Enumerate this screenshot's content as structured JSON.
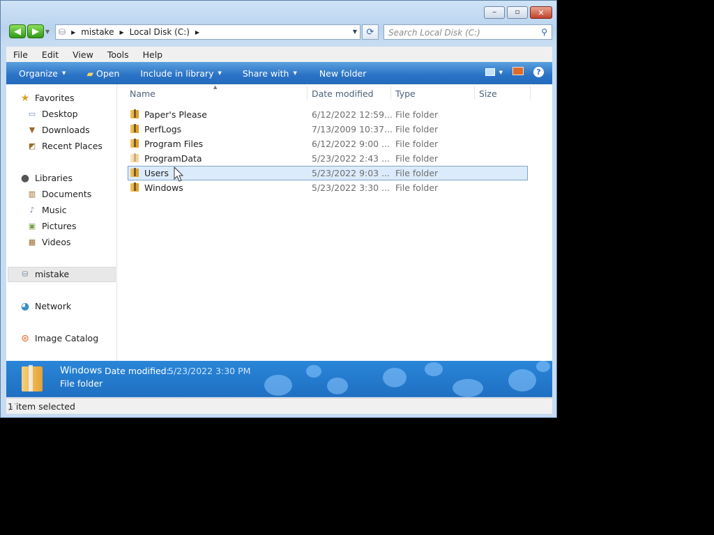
{
  "window": {
    "caption": {
      "minimize": "‒",
      "maximize": "▫",
      "close": "✕"
    }
  },
  "nav": {
    "back_icon": "arrow-left",
    "forward_icon": "arrow-right"
  },
  "address": {
    "crumbs": [
      "mistake",
      "Local Disk (C:)"
    ]
  },
  "search": {
    "placeholder": "Search Local Disk (C:)"
  },
  "menu": [
    "File",
    "Edit",
    "View",
    "Tools",
    "Help"
  ],
  "toolbar": {
    "organize": "Organize",
    "open": "Open",
    "include_in_library": "Include in library",
    "share_with": "Share with",
    "new_folder": "New folder",
    "help": "?"
  },
  "navpane": {
    "favorites": "Favorites",
    "desktop": "Desktop",
    "downloads": "Downloads",
    "recent_places": "Recent Places",
    "libraries": "Libraries",
    "documents": "Documents",
    "music": "Music",
    "pictures": "Pictures",
    "videos": "Videos",
    "computer": "mistake",
    "network": "Network",
    "image_catalog": "Image Catalog"
  },
  "columns": {
    "name": "Name",
    "date": "Date modified",
    "type": "Type",
    "size": "Size"
  },
  "files": [
    {
      "name": "Paper's Please",
      "date": "6/12/2022 12:59...",
      "type": "File folder"
    },
    {
      "name": "PerfLogs",
      "date": "7/13/2009 10:37...",
      "type": "File folder"
    },
    {
      "name": "Program Files",
      "date": "6/12/2022 9:00 ...",
      "type": "File folder"
    },
    {
      "name": "ProgramData",
      "date": "5/23/2022 2:43 ...",
      "type": "File folder"
    },
    {
      "name": "Users",
      "date": "5/23/2022 9:03 ...",
      "type": "File folder"
    },
    {
      "name": "Windows",
      "date": "5/23/2022 3:30 ...",
      "type": "File folder"
    }
  ],
  "details": {
    "name": "Windows",
    "date_label": "Date modified:",
    "date_value": "5/23/2022 3:30 PM",
    "type": "File folder"
  },
  "status": "1 item selected",
  "colors": {
    "accent": "#2a72c5",
    "selection": "#dcebfc"
  }
}
